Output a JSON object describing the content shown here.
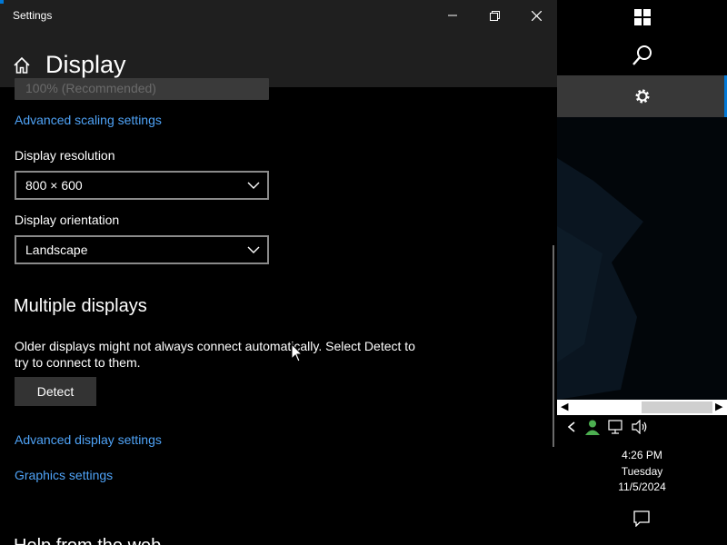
{
  "window": {
    "title": "Settings",
    "page_title": "Display"
  },
  "scale": {
    "faded_value": "100% (Recommended)",
    "advanced_scaling_link": "Advanced scaling settings"
  },
  "resolution": {
    "label": "Display resolution",
    "value": "800 × 600"
  },
  "orientation": {
    "label": "Display orientation",
    "value": "Landscape"
  },
  "multiple_displays": {
    "heading": "Multiple displays",
    "description": "Older displays might not always connect automatically. Select Detect to try to connect to them.",
    "detect_button": "Detect",
    "advanced_display_link": "Advanced display settings",
    "graphics_link": "Graphics settings"
  },
  "partial_heading": "Help from the web",
  "taskbar": {
    "time": "4:26 PM",
    "day": "Tuesday",
    "date": "11/5/2024"
  },
  "colors": {
    "accent": "#0078d7",
    "link": "#4fa3f7",
    "titlebar": "#1f1f1f"
  }
}
